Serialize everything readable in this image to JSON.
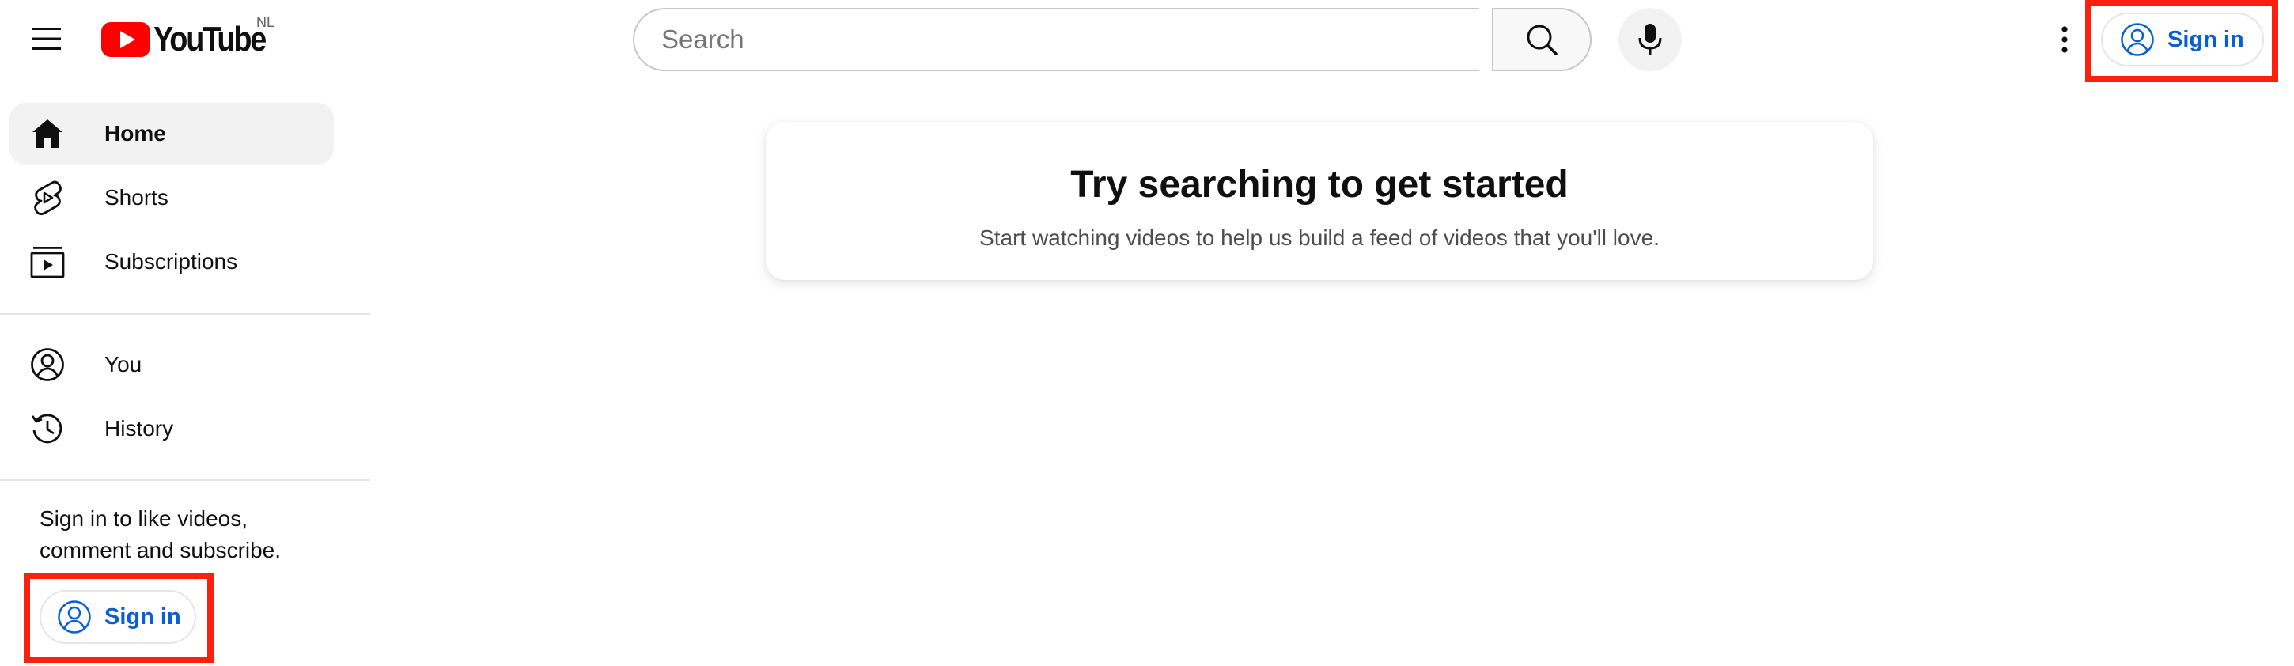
{
  "header": {
    "logo_text": "YouTube",
    "country_code": "NL",
    "search_placeholder": "Search",
    "sign_in_label": "Sign in",
    "icons": {
      "menu": "hamburger-menu-icon",
      "logo": "youtube-play-icon",
      "search": "search-icon",
      "mic": "microphone-icon",
      "more": "more-vertical-icon",
      "account": "account-circle-icon"
    },
    "colors": {
      "brand_red": "#ff0000",
      "link_blue": "#065fd4",
      "highlight_red": "#ff1f0f"
    }
  },
  "sidebar": {
    "items": [
      {
        "label": "Home",
        "icon": "home-icon",
        "active": true
      },
      {
        "label": "Shorts",
        "icon": "shorts-icon",
        "active": false
      },
      {
        "label": "Subscriptions",
        "icon": "subscriptions-icon",
        "active": false
      },
      {
        "label": "You",
        "icon": "account-circle-icon",
        "active": false
      },
      {
        "label": "History",
        "icon": "history-icon",
        "active": false
      }
    ],
    "signin_prompt": "Sign in to like videos, comment and subscribe.",
    "sign_in_label": "Sign in"
  },
  "main": {
    "title": "Try searching to get started",
    "subtitle": "Start watching videos to help us build a feed of videos that you'll love."
  }
}
